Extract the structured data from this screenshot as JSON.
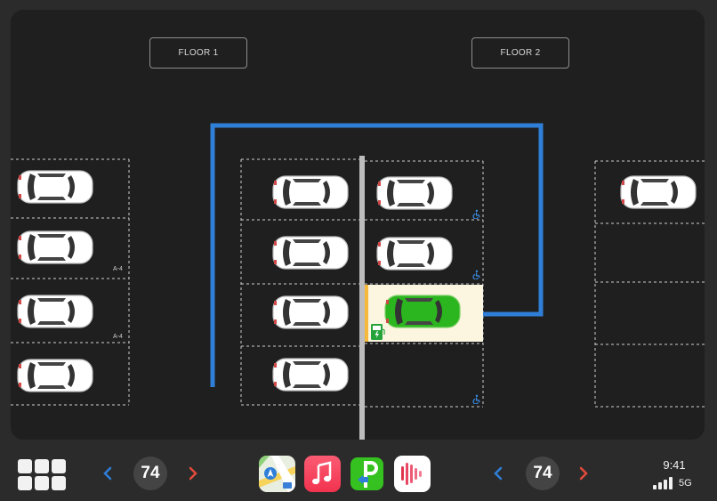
{
  "map": {
    "floor_buttons": [
      "FLOOR 1",
      "FLOOR 2"
    ],
    "spot_labels": [
      "A-4",
      "A-4"
    ],
    "route_color": "#2f7fd8",
    "parked_car_color": "#ffffff",
    "selected_car_color": "#2bb51f",
    "highlight_color": "#fcf5e0",
    "accessibility_icon": "wheelchair-icon",
    "charging_icon": "ev-charging-icon"
  },
  "dock": {
    "menu_icon": "app-grid-icon",
    "left_temperature": "74",
    "right_temperature": "74",
    "apps": [
      "maps-app-icon",
      "music-app-icon",
      "parking-app-icon",
      "podcast-app-icon"
    ],
    "time": "9:41",
    "network": "5G",
    "accent_left": "#2f7fd8",
    "accent_right": "#e24b3b"
  }
}
